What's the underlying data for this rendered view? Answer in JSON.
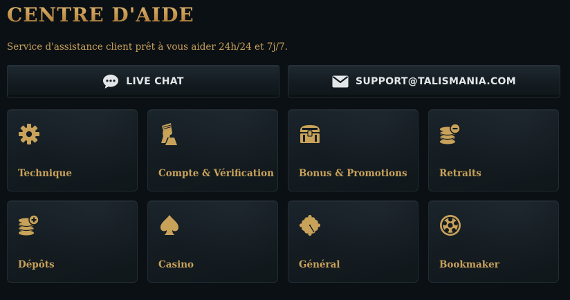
{
  "header": {
    "title": "CENTRE D'AIDE",
    "subtitle": "Service d'assistance client prêt à vous aider 24h/24 et 7j/7."
  },
  "contact": {
    "chat": {
      "label": "LIVE CHAT",
      "icon": "chat-bubble-icon"
    },
    "email": {
      "label": "SUPPORT@TALISMANIA.COM",
      "icon": "envelope-icon"
    }
  },
  "categories": [
    {
      "label": "Technique",
      "icon": "gear-icon"
    },
    {
      "label": "Compte & Vérification",
      "icon": "pharaoh-head-icon"
    },
    {
      "label": "Bonus & Promotions",
      "icon": "treasure-chest-icon"
    },
    {
      "label": "Retraits",
      "icon": "coins-minus-icon"
    },
    {
      "label": "Dépôts",
      "icon": "coins-plus-icon"
    },
    {
      "label": "Casino",
      "icon": "spade-icon"
    },
    {
      "label": "Général",
      "icon": "clover-icon"
    },
    {
      "label": "Bookmaker",
      "icon": "football-icon"
    }
  ],
  "colors": {
    "background": "#0b1014",
    "gold": "#c9a25a",
    "card": "#141c21",
    "button_text": "#e3e6e8"
  }
}
